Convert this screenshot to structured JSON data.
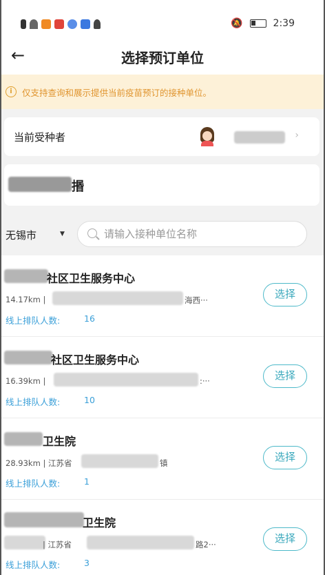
{
  "status_bar": {
    "time": "2:39"
  },
  "header": {
    "title": "选择预订单位",
    "back_icon": "←"
  },
  "notice": {
    "icon": "ⓘ",
    "text": "仅支持查询和展示提供当前疫苗预订的接种单位。",
    "color": "#e09530"
  },
  "recipient": {
    "label": "当前受种者",
    "chevron": "›"
  },
  "selected_unit": {
    "visible_char": "㨉"
  },
  "filter": {
    "city": "无锡市",
    "city_caret": "▼",
    "search_placeholder": "请输入接种单位名称"
  },
  "units": [
    {
      "name_visible": "社区卫生服务中心",
      "distance_visible": "14.17km |",
      "address_tail": "海西···",
      "queue_label": "线上排队人数:",
      "queue_count": "16",
      "button": "选择"
    },
    {
      "name_visible": "社区卫生服务中心",
      "distance_visible": "16.39km |",
      "address_tail": ":···",
      "queue_label": "线上排队人数:",
      "queue_count": "10",
      "button": "选择"
    },
    {
      "name_visible": "卫生院",
      "distance_visible": "28.93km | 江苏省",
      "address_tail": "镇",
      "queue_label": "线上排队人数:",
      "queue_count": "1",
      "button": "选择"
    },
    {
      "name_visible": "卫生院",
      "distance_visible": "| 江苏省",
      "address_tail": "路2···",
      "queue_label": "线上排队人数:",
      "queue_count": "3",
      "button": "选择"
    }
  ],
  "colors": {
    "accent": "#3aa8bc",
    "queue": "#3a9fd8",
    "notice_bg": "#fdf1d8"
  }
}
